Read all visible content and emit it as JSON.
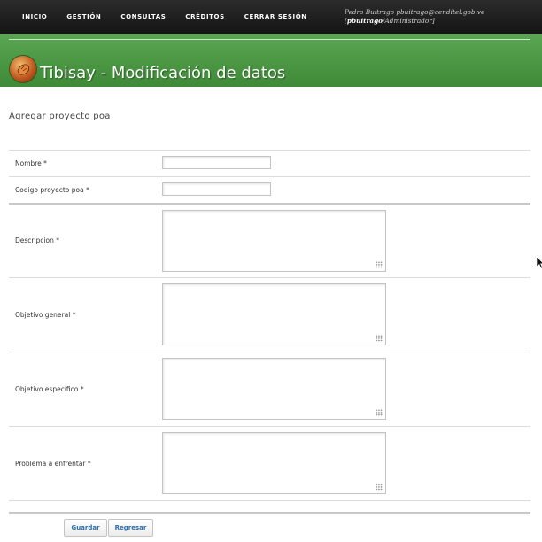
{
  "nav": {
    "items": [
      "INICIO",
      "GESTIÓN",
      "CONSULTAS",
      "CRÉDITOS",
      "CERRAR SESIÓN"
    ]
  },
  "user": {
    "line1": "Pedro Buitrago pbuitrago@cenditel.gob.ve",
    "bracket_open": "[",
    "username": "pbuitrago",
    "role": "/Administrador]"
  },
  "banner": {
    "title": "Tibisay - Modificación de datos",
    "logo_icon": "tibisay-logo-icon"
  },
  "section": {
    "title": "Agregar proyecto poa"
  },
  "form": {
    "fields": [
      {
        "label": "Nombre *",
        "type": "text",
        "value": ""
      },
      {
        "label": "Codigo proyecto poa *",
        "type": "text",
        "value": ""
      },
      {
        "label": "Descripcion *",
        "type": "textarea",
        "value": ""
      },
      {
        "label": "Objetivo general *",
        "type": "textarea",
        "value": ""
      },
      {
        "label": "Objetivo específico *",
        "type": "textarea",
        "value": ""
      },
      {
        "label": "Problema a enfrentar *",
        "type": "textarea",
        "value": ""
      }
    ],
    "buttons": {
      "save": "Guardar",
      "back": "Regresar"
    }
  },
  "colors": {
    "topbar": "#1e1e1e",
    "banner": "#4c9a45",
    "button_text": "#2a6fb0"
  }
}
